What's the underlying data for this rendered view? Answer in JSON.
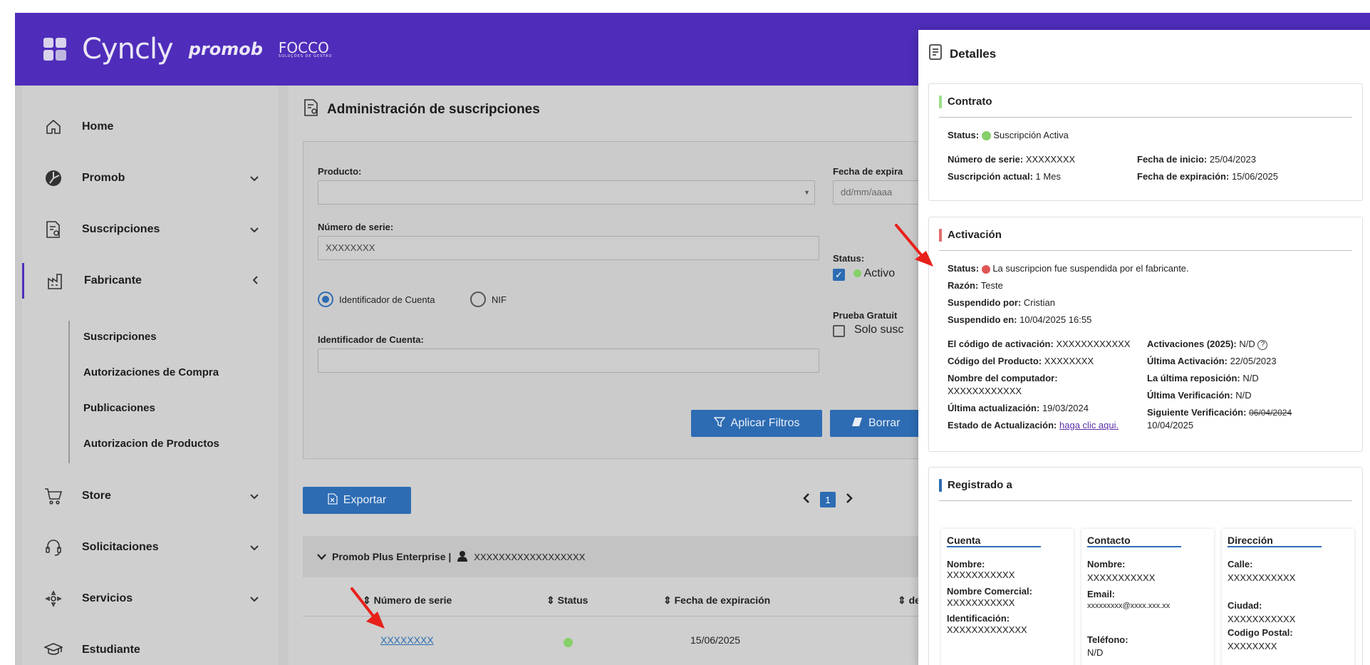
{
  "brand": {
    "name": "Cyncly",
    "partner1": "promob",
    "partner2": "FOCCO",
    "partner2_tag": "SOLUÇÕES DE GESTÃO"
  },
  "sidebar": {
    "items": [
      {
        "label": "Home",
        "icon": "home-icon"
      },
      {
        "label": "Promob",
        "icon": "promob-icon"
      },
      {
        "label": "Suscripciones",
        "icon": "subscription-doc-icon"
      },
      {
        "label": "Fabricante",
        "icon": "factory-icon"
      },
      {
        "label": "Store",
        "icon": "cart-icon"
      },
      {
        "label": "Solicitaciones",
        "icon": "headset-icon"
      },
      {
        "label": "Servicios",
        "icon": "services-icon"
      },
      {
        "label": "Estudiante",
        "icon": "graduation-cap-icon"
      }
    ],
    "sub_items": [
      "Suscripciones",
      "Autorizaciones de Compra",
      "Publicaciones",
      "Autorizacion de Productos"
    ]
  },
  "main": {
    "title": "Administración de suscripciones",
    "filters": {
      "product_label": "Producto:",
      "product_value": "",
      "serial_label": "Número de serie:",
      "serial_value": "XXXXXXXX",
      "radio_account": "Identificador de Cuenta",
      "radio_nif": "NIF",
      "account_label": "Identificador de Cuenta:",
      "account_value": "",
      "expiry_label": "Fecha de expira",
      "expiry_placeholder": "dd/mm/aaaa",
      "status_label": "Status:",
      "status_active": "Activo",
      "trial_label": "Prueba Gratuit",
      "trial_only": "Solo susc",
      "apply_button": "Aplicar Filtros",
      "clear_button": "Borrar"
    },
    "export_button": "Exportar",
    "pager_current": "1",
    "group": {
      "product": "Promob Plus Enterprise |",
      "account": "XXXXXXXXXXXXXXXXXX"
    },
    "table": {
      "headers": [
        "Número de serie",
        "Status",
        "Fecha de expiración",
        "de"
      ],
      "rows": [
        {
          "serial": "XXXXXXXX",
          "status": "active",
          "expiry": "15/06/2025"
        }
      ]
    }
  },
  "details": {
    "title": "Detalles",
    "contract": {
      "title": "Contrato",
      "status_label": "Status:",
      "status_value": "Suscripción Activa",
      "serial_label": "Número de serie:",
      "serial_value": "XXXXXXXX",
      "start_label": "Fecha de inicio:",
      "start_value": "25/04/2023",
      "current_label": "Suscripción actual:",
      "current_value": "1 Mes",
      "expiry_label": "Fecha de expiración:",
      "expiry_value": "15/06/2025"
    },
    "activation": {
      "title": "Activación",
      "status_label": "Status:",
      "status_value": "La suscripcion fue suspendida por el fabricante.",
      "reason_label": "Razón:",
      "reason_value": "Teste",
      "suspended_by_label": "Suspendido por:",
      "suspended_by_value": "Cristian",
      "suspended_on_label": "Suspendido en:",
      "suspended_on_value": "10/04/2025 16:55",
      "code_label": "El código de activación:",
      "code_value": "XXXXXXXXXXXX",
      "product_code_label": "Código del Producto:",
      "product_code_value": "XXXXXXXX",
      "computer_label": "Nombre del computador:",
      "computer_value": "XXXXXXXXXXXX",
      "last_update_label": "Última actualización:",
      "last_update_value": "19/03/2024",
      "update_state_label": "Estado de Actualización:",
      "update_state_link": "haga clic aqui.",
      "activations_label": "Activaciones (2025):",
      "activations_value": "N/D",
      "last_activation_label": "Última Activación:",
      "last_activation_value": "22/05/2023",
      "last_reset_label": "La última reposición:",
      "last_reset_value": "N/D",
      "last_verif_label": "Última Verificación:",
      "last_verif_value": "N/D",
      "next_verif_label": "Siguiente Verificación:",
      "next_verif_old": "06/04/2024",
      "next_verif_value": "10/04/2025"
    },
    "registered": {
      "title": "Registrado a",
      "account": {
        "title": "Cuenta",
        "name_label": "Nombre:",
        "name_value": "XXXXXXXXXXX",
        "commercial_label": "Nombre Comercial:",
        "commercial_value": "XXXXXXXXXXX",
        "id_label": "Identificación:",
        "id_value": "XXXXXXXXXXXXX"
      },
      "contact": {
        "title": "Contacto",
        "name_label": "Nombre:",
        "name_value": "XXXXXXXXXXX",
        "email_label": "Email:",
        "email_value": "xxxxxxxxx@xxxx.xxx.xx",
        "phone_label": "Teléfono:",
        "phone_value": "N/D"
      },
      "address": {
        "title": "Dirección",
        "street_label": "Calle:",
        "street_value": "XXXXXXXXXXX",
        "city_label": "Ciudad:",
        "city_value": "XXXXXXXXXXX",
        "zip_label": "Codigo Postal:",
        "zip_value": "XXXXXXXX"
      }
    }
  },
  "colors": {
    "brand_purple": "#4f2dba",
    "primary_blue": "#2d6cb3",
    "active_green": "#86d06a",
    "suspended_red": "#e05555",
    "annotation_red": "#e8201a"
  }
}
